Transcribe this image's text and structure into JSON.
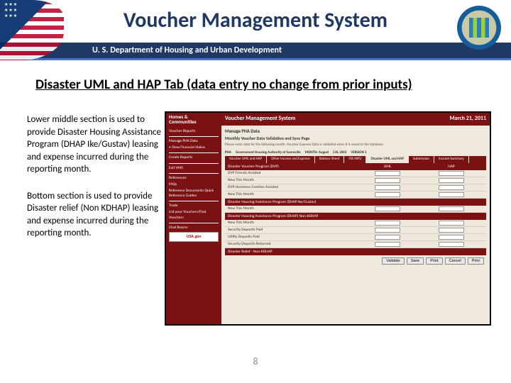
{
  "slide": {
    "title": "Voucher Management System",
    "deptBar": "U. S. Department of Housing and Urban Development",
    "subtitle": "Disaster UML and HAP Tab (data entry no change from prior inputs)",
    "leftPara1": "Lower middle section is used to provide Disaster Housing Assistance Program (DHAP Ike/Gustav) leasing and expense incurred during the reporting month.",
    "leftPara2": "Bottom section is used to provide Disaster relief (Non KDHAP) leasing and expense incurred during the reporting month.",
    "pageNumber": "8"
  },
  "screenshot": {
    "logoLine1": "Homes &",
    "logoLine2": "Communities",
    "appTitle": "Voucher Management System",
    "date": "March 21, 2011",
    "sidebar": {
      "items": [
        "Voucher Reports",
        "",
        "Manage PHA Data",
        "• View Financial Status",
        "",
        "Create Reports",
        "",
        "Exit VMS",
        "",
        "References",
        "FAQs",
        "Reference Documents Quick Reference Guides",
        "",
        "Trade",
        "List your Vouchers/Find Vouchers",
        "",
        "Chat Rooms"
      ],
      "usaGov": "USA.gov"
    },
    "main": {
      "pageHeader": "Manage PHA Data",
      "subheader": "Monthly Voucher Data Validation and Sync Page",
      "desc": "Please enter data for the following month. Voucher Expense Data is validated when it is saved to the database.",
      "info": {
        "pha": "PHA",
        "phaVal": "",
        "fy": "Government Housing Authority of Someville",
        "fyVal": "MONTH: August",
        "code": "CAL 2003",
        "ver": "VERSION 1"
      },
      "tabs": [
        "Voucher UML and HAP",
        "Other Income and Expense",
        "Balance Sheet",
        "FSS INFO",
        "Disaster UML and HAP",
        "Submission",
        "Income Summary"
      ],
      "activeTab": "Disaster UML and HAP",
      "sections": [
        {
          "header": {
            "c1": "Disaster Voucher Program (DVP)",
            "c2": "UML",
            "c3": "HAP"
          },
          "rows": [
            "DVP Friends Assisted",
            "New This Month",
            "DVP Homeless Families Assisted",
            "New This Month"
          ]
        },
        {
          "header": {
            "c1": "Disaster Housing Assistance Program (DHAP Ike/Gustav)",
            "c2": "",
            "c3": ""
          },
          "rows": [
            "New This Month"
          ]
        },
        {
          "header": {
            "c1": "Disaster Housing Assistance Program (DHAP) Non-KDHAP",
            "c2": "",
            "c3": ""
          },
          "rows": [
            "New This Month",
            "Security Deposits Paid",
            "Utility Deposits Paid",
            "Security Deposits Returned"
          ]
        },
        {
          "header": {
            "c1": "Disaster Relief - Non-KDHAP",
            "c2": "",
            "c3": ""
          },
          "rows": []
        }
      ],
      "buttons": [
        "Validate",
        "Save",
        "Print",
        "Cancel",
        "Print"
      ]
    }
  }
}
